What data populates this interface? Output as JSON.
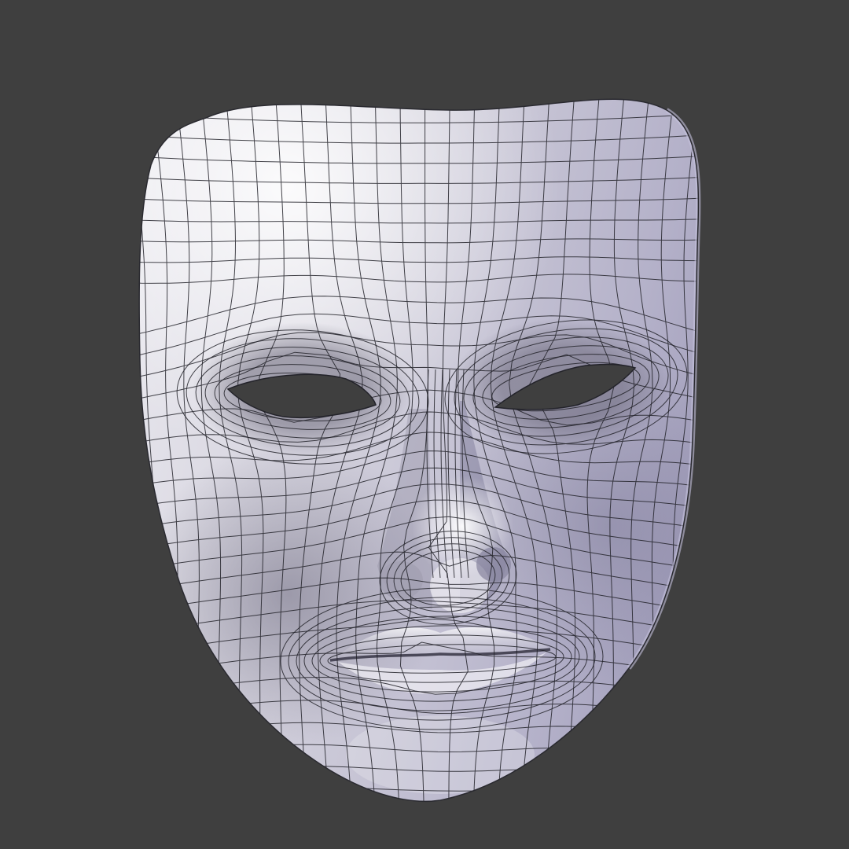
{
  "scene": {
    "background_color": "#3f3f3f",
    "object": "face-mask",
    "surface_color": "#d8d7dd",
    "surface_highlight": "#f4f3f6",
    "surface_shadow": "#8e8b9f",
    "rim_tint": "#b9b7d3",
    "wire_color": "#23232a",
    "eye_hole_color": "#3f3f3f",
    "shading": "solid",
    "overlay": "wireframe"
  }
}
